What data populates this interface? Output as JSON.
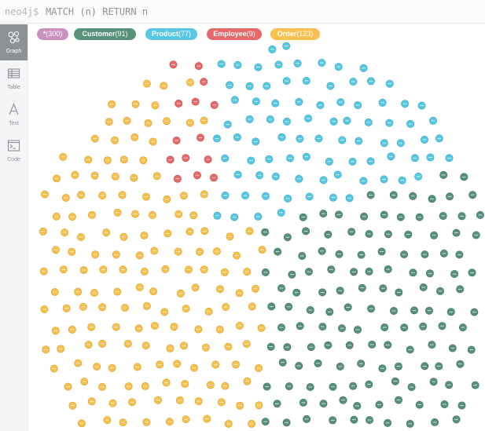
{
  "editor": {
    "prompt": "neo4j$",
    "query": "MATCH (n) RETURN n"
  },
  "sidebar": {
    "items": [
      {
        "label": "Graph",
        "icon": "graph-icon",
        "active": true
      },
      {
        "label": "Table",
        "icon": "table-icon",
        "active": false
      },
      {
        "label": "Text",
        "icon": "text-icon",
        "active": false
      },
      {
        "label": "Code",
        "icon": "code-icon",
        "active": false
      }
    ]
  },
  "legend": [
    {
      "name": "*",
      "count": "(300)",
      "color": "#c990c0",
      "key": "all"
    },
    {
      "name": "Customer",
      "count": "(91)",
      "color": "#57917a",
      "key": "customer"
    },
    {
      "name": "Product",
      "count": "(77)",
      "color": "#57c7e3",
      "key": "product"
    },
    {
      "name": "Employee",
      "count": "(9)",
      "color": "#e66868",
      "key": "employee"
    },
    {
      "name": "Order",
      "count": "(123)",
      "color": "#f7c04f",
      "key": "order"
    }
  ],
  "colors": {
    "customer": "#57917a",
    "customer_stroke": "#467a66",
    "product": "#57c7e3",
    "product_stroke": "#3fb0cc",
    "employee": "#e66868",
    "employee_stroke": "#cf5555",
    "order": "#f7c04f",
    "order_stroke": "#e0a935"
  }
}
